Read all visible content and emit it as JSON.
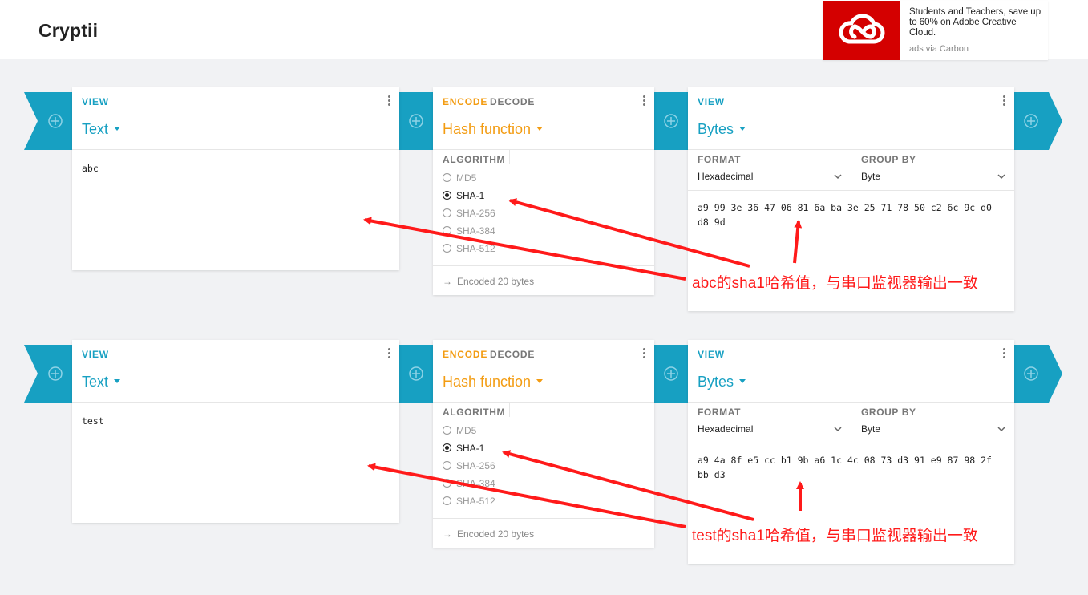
{
  "app": {
    "title": "Cryptii"
  },
  "ad": {
    "text": "Students and Teachers, save up to 60% on Adobe Creative Cloud.",
    "via": "ads via Carbon"
  },
  "pipelines": [
    {
      "view_in": {
        "tag": "VIEW",
        "title": "Text",
        "content": "abc"
      },
      "hash": {
        "encode": "ENCODE",
        "decode": "DECODE",
        "title": "Hash function",
        "algorithm_label": "ALGORITHM",
        "algorithms": [
          "MD5",
          "SHA-1",
          "SHA-256",
          "SHA-384",
          "SHA-512"
        ],
        "selected": "SHA-1",
        "status": "Encoded 20 bytes"
      },
      "view_out": {
        "tag": "VIEW",
        "title": "Bytes",
        "format_label": "FORMAT",
        "format_value": "Hexadecimal",
        "group_label": "GROUP BY",
        "group_value": "Byte",
        "hex_line1": "a9 99 3e 36 47 06 81 6a ba 3e 25 71 78 50 c2 6c 9c d0",
        "hex_line2": "d8 9d"
      },
      "annotation": "abc的sha1哈希值，与串口监视器输出一致"
    },
    {
      "view_in": {
        "tag": "VIEW",
        "title": "Text",
        "content": "test"
      },
      "hash": {
        "encode": "ENCODE",
        "decode": "DECODE",
        "title": "Hash function",
        "algorithm_label": "ALGORITHM",
        "algorithms": [
          "MD5",
          "SHA-1",
          "SHA-256",
          "SHA-384",
          "SHA-512"
        ],
        "selected": "SHA-1",
        "status": "Encoded 20 bytes"
      },
      "view_out": {
        "tag": "VIEW",
        "title": "Bytes",
        "format_label": "FORMAT",
        "format_value": "Hexadecimal",
        "group_label": "GROUP BY",
        "group_value": "Byte",
        "hex_line1": "a9 4a 8f e5 cc b1 9b a6 1c 4c 08 73 d3 91 e9 87 98 2f",
        "hex_line2": "bb d3"
      },
      "annotation": "test的sha1哈希值，与串口监视器输出一致"
    }
  ],
  "colors": {
    "accent": "#17a0c2",
    "encoder": "#f39c12",
    "annotation": "#ff1a1a",
    "ad_brand": "#d40000"
  },
  "icons": [
    "add-circle-icon",
    "more-vert-icon",
    "caret-down-icon",
    "chevron-down-icon",
    "arrow-right-icon",
    "creative-cloud-icon"
  ]
}
